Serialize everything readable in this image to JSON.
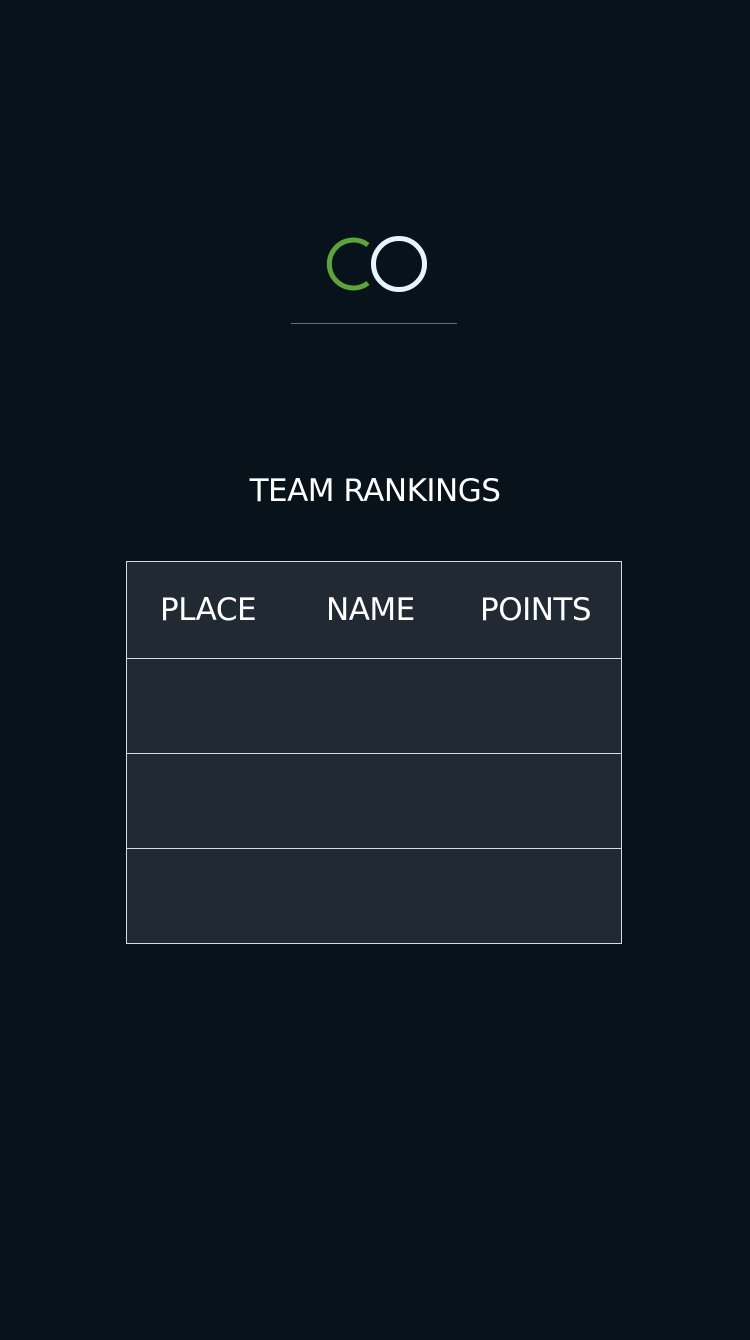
{
  "logo": {
    "icon": "brand-logo-icon",
    "colors": {
      "left_ring": "#5ba53c",
      "right_ring": "#e6f4fb"
    }
  },
  "title": "TEAM RANKINGS",
  "rankings": {
    "columns": [
      "PLACE",
      "NAME",
      "POINTS"
    ],
    "rows": [
      {
        "place": "",
        "name": "",
        "points": ""
      },
      {
        "place": "",
        "name": "",
        "points": ""
      },
      {
        "place": "",
        "name": "",
        "points": ""
      }
    ]
  },
  "colors": {
    "background": "#07121b",
    "table_background": "#212a33",
    "table_border": "#d7dbdf"
  }
}
